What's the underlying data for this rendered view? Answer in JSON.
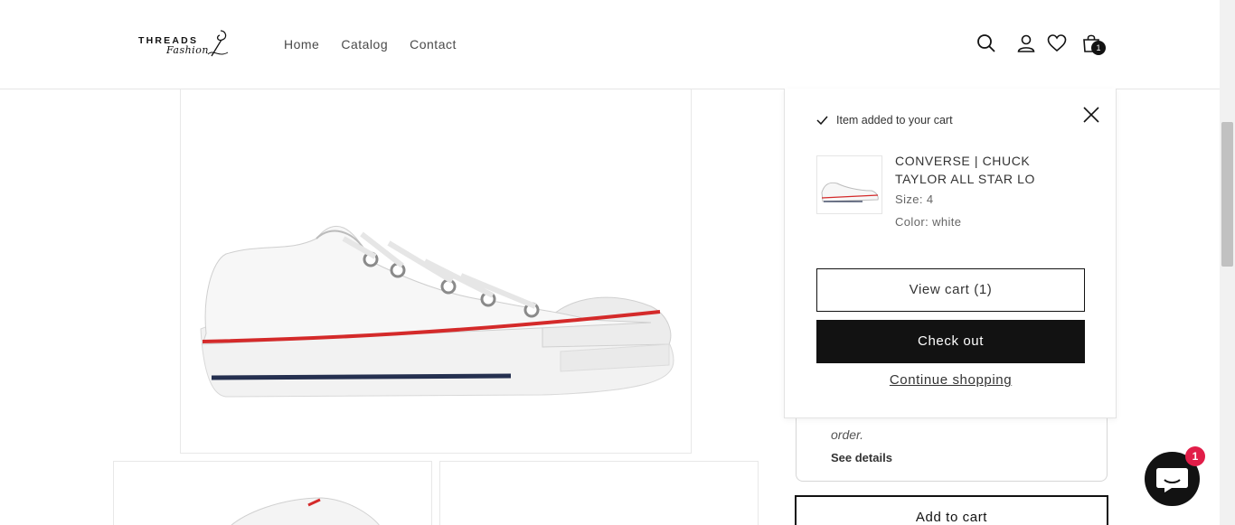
{
  "brand": {
    "word": "THREADS",
    "script": "Fashion"
  },
  "nav": {
    "home": "Home",
    "catalog": "Catalog",
    "contact": "Contact"
  },
  "header_icons": {
    "search": "search-icon",
    "account": "user-icon",
    "wishlist": "heart-icon",
    "cart": "bag-icon",
    "cart_count": "1"
  },
  "notification": {
    "message": "Item added to your cart",
    "product_name": "CONVERSE | CHUCK TAYLOR ALL STAR LO",
    "size": "Size: 4",
    "color": "Color: white",
    "view_cart": "View cart (1)",
    "checkout": "Check out",
    "continue": "Continue shopping"
  },
  "info": {
    "italic_text": "order.",
    "see_details": "See details"
  },
  "product": {
    "add_to_cart": "Add to cart"
  },
  "chat": {
    "badge": "1"
  },
  "colors": {
    "accent_dark": "#121212",
    "badge_red": "#e11d48",
    "shoe_red_stripe": "#d42a2a",
    "shoe_navy_stripe": "#253050"
  }
}
